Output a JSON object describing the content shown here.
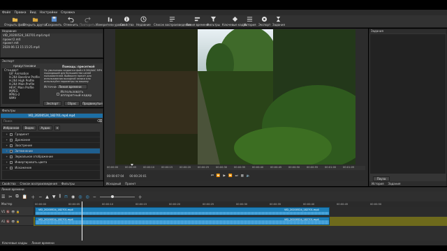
{
  "menu": [
    "Файл",
    "Правка",
    "Вид",
    "Настройки",
    "Справка"
  ],
  "toolbar": [
    {
      "label": "Открыть файл",
      "icon": "folder-open-icon"
    },
    {
      "label": "Открыть другой",
      "icon": "folder-icon"
    },
    {
      "label": "Сохранить",
      "icon": "save-icon"
    },
    {
      "label": "Отменить",
      "icon": "undo-icon"
    },
    {
      "label": "Повторить",
      "icon": "redo-icon"
    },
    {
      "label": "Измерители уровня",
      "icon": "meter-icon"
    },
    {
      "label": "Свойства",
      "icon": "info-icon"
    },
    {
      "label": "Недавние",
      "icon": "recent-icon"
    },
    {
      "label": "Список воспроизведения",
      "icon": "playlist-icon"
    },
    {
      "label": "Линия времени",
      "icon": "timeline-icon"
    },
    {
      "label": "Фильтры",
      "icon": "filters-icon"
    },
    {
      "label": "Ключевые кадры",
      "icon": "keyframes-icon"
    },
    {
      "label": "История",
      "icon": "history-icon"
    },
    {
      "label": "Экспорт",
      "icon": "export-icon"
    },
    {
      "label": "Задания",
      "icon": "jobs-icon"
    }
  ],
  "properties": {
    "header": "Недавние",
    "lines": [
      "VID_20200524_182701.mp4.mp4",
      "проект2.mlt",
      "проект.mlt",
      "2020-06-13 15:15:25.mp4"
    ]
  },
  "export": {
    "header": "Экспорт",
    "presets_label": "предустановки",
    "help_title": "Помощь: пресетмоё",
    "help_text": "По умолчанию создается файл H.264/AAC MP4 подходящий для большинства целей пользователей. Выберите пресет для использования выходной записи или используйте параметры по вашему усмотрению, чтобы восстановить их.",
    "source_label": "Источник:",
    "source_value": "Линия времени",
    "hw_label": "Использовать аппаратный кодер",
    "presets": [
      "Стандарт",
      "GIF Animation",
      "H.264 Baseline Profile",
      "H.264 High Profile",
      "H.264 Main Profile",
      "HEVC Main Profile",
      "MJPEG",
      "MPEG-2",
      "WMV"
    ],
    "btn_export": "Экспорт",
    "btn_reset": "Сброс",
    "btn_advanced": "Продвинутый"
  },
  "filters": {
    "header": "Фильтры",
    "clip_name": "VID_20200524_182701.mp4.mp4",
    "search_placeholder": "Поиск",
    "tabs": [
      "Избранное",
      "Видео",
      "Аудио"
    ],
    "items": [
      "Градиент",
      "Дрожание",
      "Заострение",
      "Затемнение",
      "Зеркальное отображение",
      "Инвертировать цвета",
      "Искажение"
    ],
    "selected_index": 3
  },
  "bottom_left_tabs": [
    "Свойства",
    "Список воспроизведения",
    "Фильтры"
  ],
  "player": {
    "tc_current": "00:00:07:04",
    "tc_total": "00:00:20:01",
    "ruler": [
      "00:00:00",
      "00:00:05",
      "00:00:10",
      "00:00:15",
      "00:00:20",
      "00:00:25",
      "00:00:30",
      "00:00:35",
      "00:00:40",
      "00:00:45",
      "00:00:50",
      "00:00:55",
      "00:01:00",
      "00:01:05"
    ],
    "tab_source": "Исходный",
    "tab_project": "Проект"
  },
  "right_panel": {
    "header": "Задания",
    "btn_pause": "Пауза",
    "tab_history": "История",
    "tab_jobs": "Задания"
  },
  "timeline": {
    "header": "Линия времени",
    "master": "Мастер",
    "tracks": [
      "V1",
      "A1"
    ],
    "ruler": [
      "00:00:00",
      "00:00:05",
      "00:00:10",
      "00:00:15",
      "00:00:20",
      "00:00:25",
      "00:00:30",
      "00:00:35",
      "00:00:40",
      "00:00:45",
      "00:00:50"
    ],
    "clip_label": "VID_20200524_182701.mp4"
  },
  "footer_tabs": [
    "Ключевые кадры",
    "Линия времени"
  ]
}
